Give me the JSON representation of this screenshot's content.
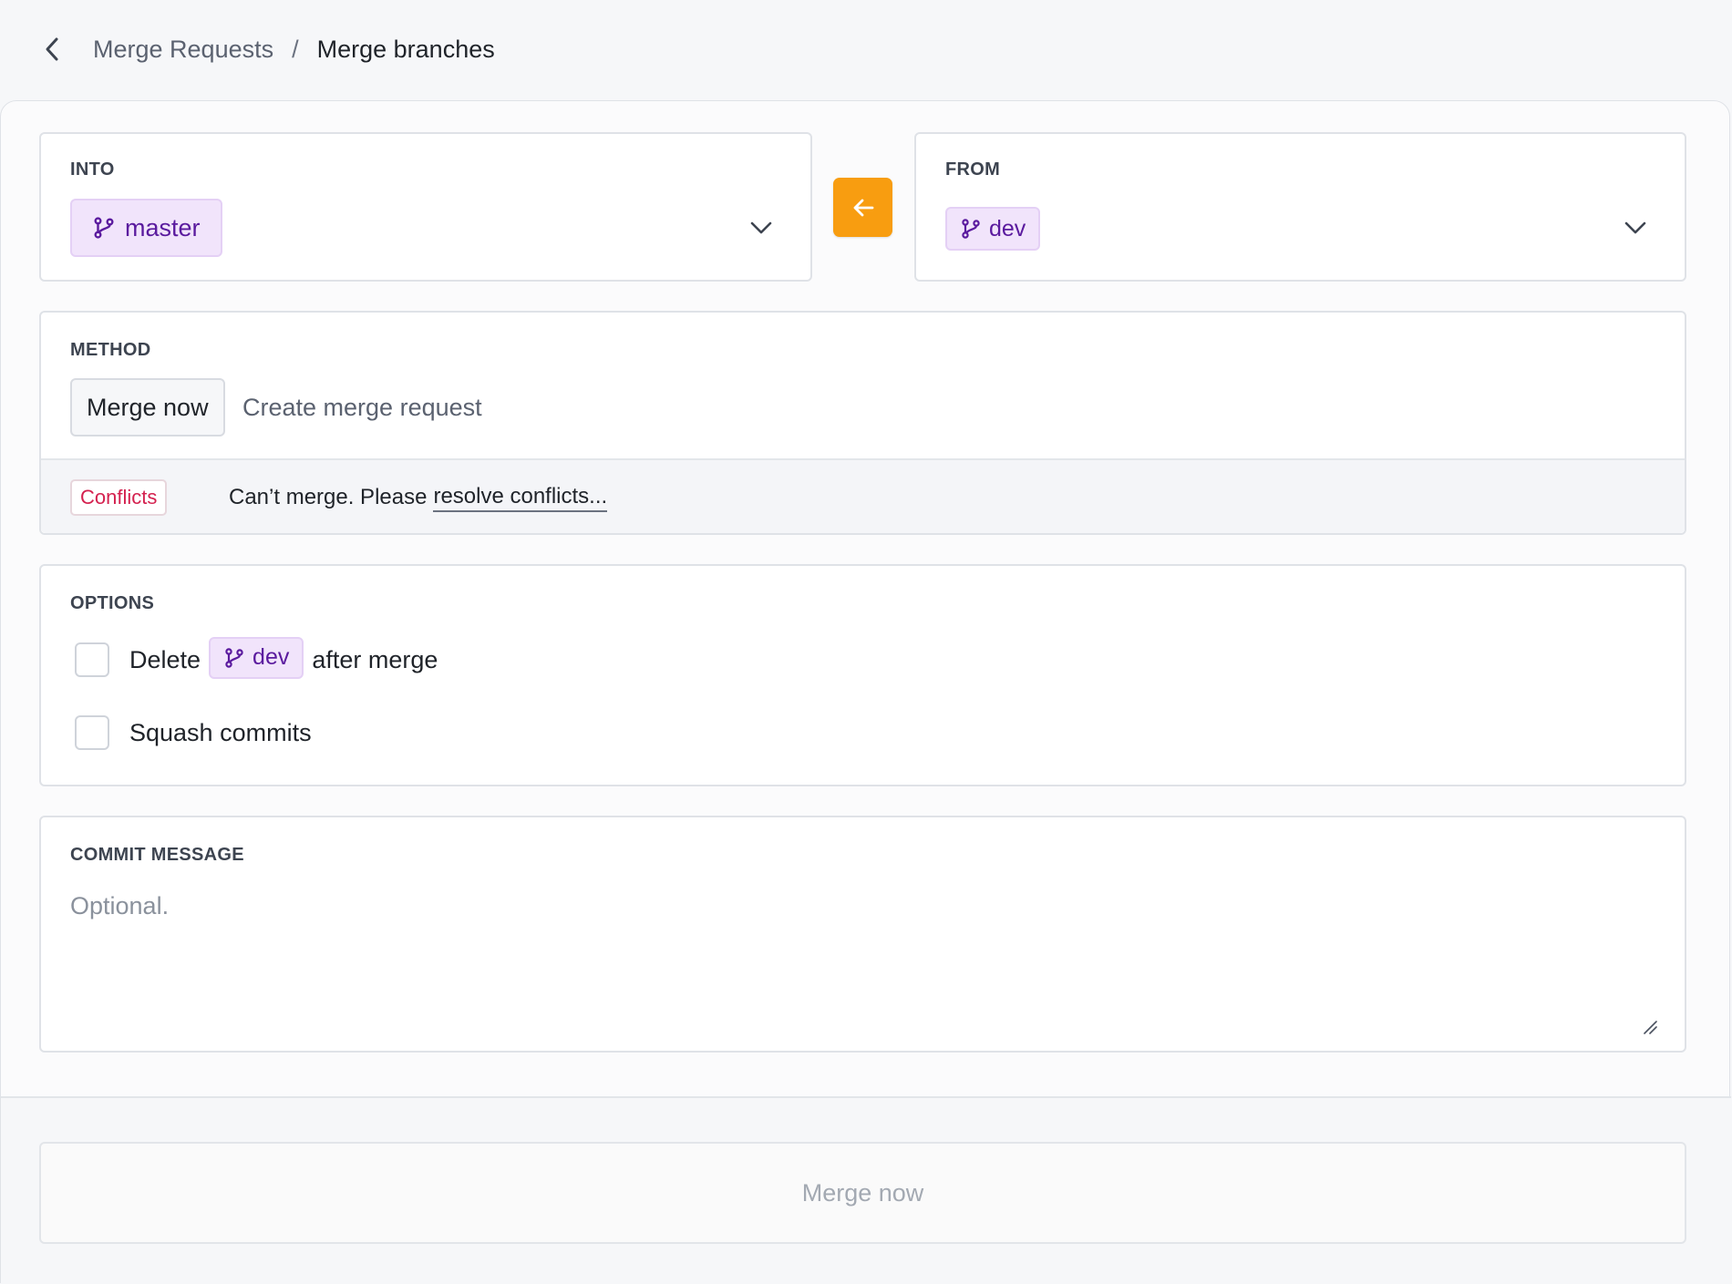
{
  "breadcrumb": {
    "parent": "Merge Requests",
    "separator": "/",
    "current": "Merge branches"
  },
  "into": {
    "label": "INTO",
    "branch": "master"
  },
  "from": {
    "label": "FROM",
    "branch": "dev"
  },
  "method": {
    "label": "METHOD",
    "active": "Merge now",
    "alternative": "Create merge request"
  },
  "conflict": {
    "badge": "Conflicts",
    "text": "Can’t merge. Please",
    "link": "resolve conflicts..."
  },
  "options": {
    "label": "OPTIONS",
    "delete_prefix": "Delete",
    "delete_branch": "dev",
    "delete_suffix": "after merge",
    "squash": "Squash commits"
  },
  "commit": {
    "label": "COMMIT MESSAGE",
    "placeholder": "Optional."
  },
  "footer": {
    "merge_button": "Merge now"
  },
  "colors": {
    "accent": "#f89d10",
    "branch_bg": "#f1e4fb",
    "branch_text": "#5a1a9e",
    "conflict": "#d4214f"
  }
}
